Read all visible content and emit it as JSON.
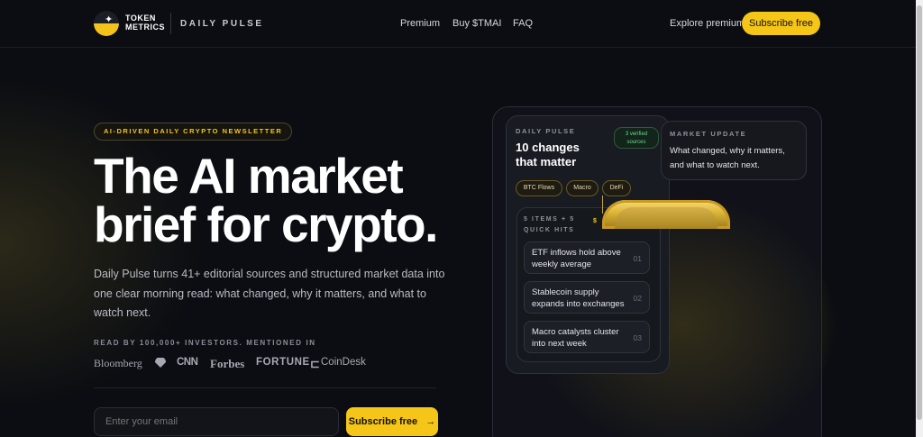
{
  "header": {
    "brand_line1": "TOKEN",
    "brand_line2": "METRICS",
    "product": "DAILY PULSE",
    "nav": [
      "Premium",
      "Buy $TMAI",
      "FAQ"
    ],
    "explore": "Explore premium",
    "subscribe": "Subscribe free"
  },
  "hero": {
    "pill": "AI-DRIVEN DAILY CRYPTO NEWSLETTER",
    "title_line1": "The AI market",
    "title_line2": "brief for crypto.",
    "subtitle": "Daily Pulse turns 41+ editorial sources and structured market data into one clear morning read: what changed, why it matters, and what to watch next.",
    "read_by": "READ BY 100,000+ INVESTORS. MENTIONED IN",
    "publications": [
      "Bloomberg",
      "CNN",
      "Forbes",
      "FORTUNE",
      "CoinDesk"
    ],
    "email_placeholder": "Enter your email",
    "subscribe": "Subscribe free",
    "subscribe_arrow": "→"
  },
  "card": {
    "label": "DAILY PULSE",
    "title_line1": "10 changes",
    "title_line2": "that matter",
    "verified_line1": "3 verified",
    "verified_line2": "sources",
    "tags": [
      "BTC Flows",
      "Macro",
      "DeFi"
    ],
    "items_label_line1": "5 ITEMS + 5",
    "items_label_line2": "QUICK HITS",
    "items": [
      {
        "text": "ETF inflows hold above weekly average",
        "num": "01"
      },
      {
        "text": "Stablecoin supply expands into exchanges",
        "num": "02"
      },
      {
        "text": "Macro catalysts cluster into next week",
        "num": "03"
      }
    ]
  },
  "market": {
    "label": "MARKET UPDATE",
    "text": "What changed, why it matters, and what to watch next."
  },
  "colors": {
    "accent": "#f5c518",
    "background": "#0b0d12",
    "verified": "#6cd98b"
  },
  "icons": [
    "token-metrics-logo-icon",
    "nbc-peacock-icon",
    "coindesk-icon",
    "arrow-right-icon"
  ]
}
